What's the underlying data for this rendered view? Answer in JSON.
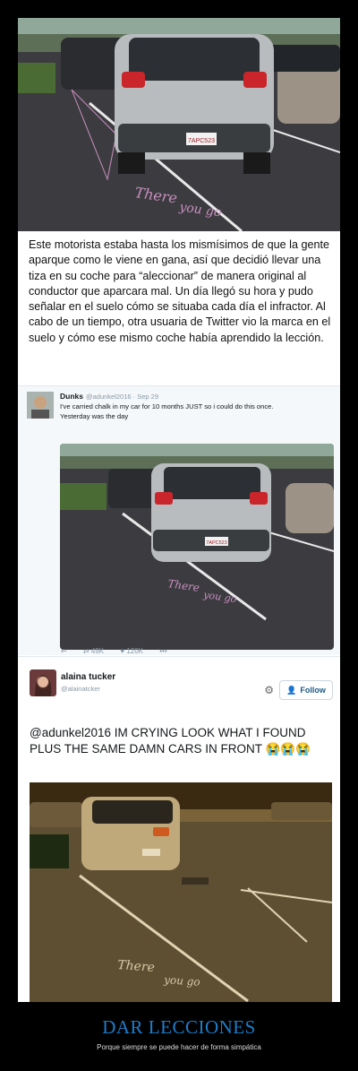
{
  "post": {
    "caption": "Este motorista estaba hasta los mismísimos de que la gente aparque como le viene en gana, así que decidió llevar una tiza en su coche para “aleccionar” de manera original al conductor que aparcara mal. Un día llegó su hora y pudo señalar en el suelo cómo se situaba cada día el infractor. Al cabo de un tiempo, otra usuaria de Twitter vio la marca en el suelo y cómo ese mismo coche había aprendido la lección."
  },
  "photo_chalk": {
    "line1": "There",
    "line2": "you go"
  },
  "plate": "7APC523",
  "tweet1": {
    "name": "Dunks",
    "meta": "@adunkel2016 · Sep 29",
    "text_line1": "I've carried chalk in my car for 10 months JUST so i could do this once.",
    "text_line2": "Yesterday was the day",
    "reply_icon": "reply-icon",
    "retweets": "49K",
    "likes": "120K",
    "more": "•••"
  },
  "tweet2": {
    "name": "alaina tucker",
    "handle": "@alainatcker",
    "follow_label": "Follow",
    "text": "@adunkel2016 IM CRYING LOOK WHAT I FOUND PLUS THE SAME DAMN CARS IN FRONT",
    "emoji": "😭😭😭"
  },
  "footer": {
    "title": "DAR LECCIONES",
    "subtitle": "Porque siempre se puede hacer de forma simpática"
  },
  "colors": {
    "twitter_blue": "#1b5a86",
    "footer_blue": "#1f7cc9",
    "chalk": "#c98fbf"
  }
}
